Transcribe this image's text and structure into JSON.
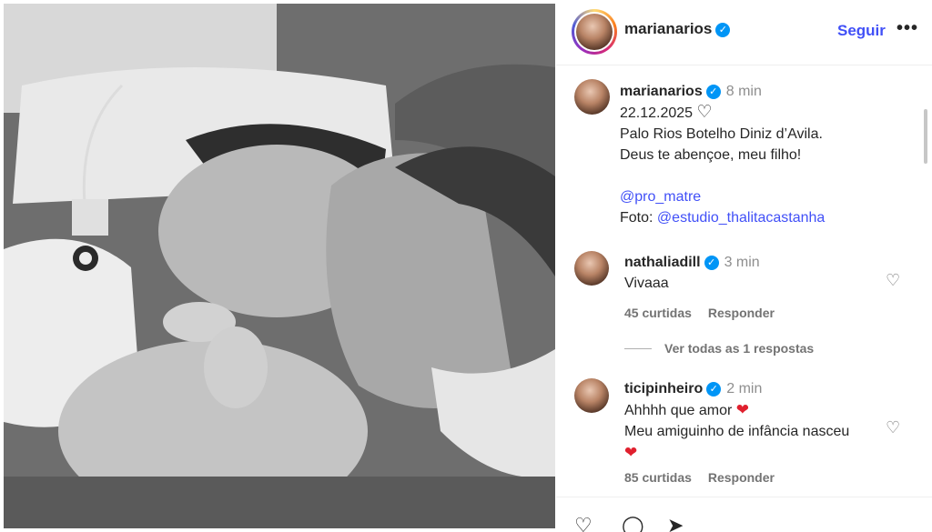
{
  "header": {
    "username": "marianarios",
    "follow_label": "Seguir",
    "more_label": "•••"
  },
  "caption": {
    "username": "marianarios",
    "time": "8 min",
    "lines": [
      "22.12.2025",
      "Palo Rios Botelho Diniz d’Avila.",
      "Deus te abençoe, meu filho!",
      "@pro_matre",
      "Foto:",
      "@estudio_thalitacastanha"
    ]
  },
  "comments": [
    {
      "username": "nathaliadill",
      "time": "3 min",
      "text": "Vivaaa",
      "likes": "45 curtidas",
      "reply_label": "Responder"
    },
    {
      "username": "ticipinheiro",
      "time": "2 min",
      "text_line1": "Ahhhh que amor",
      "text_line2": "Meu amiguinho de infância nasceu",
      "likes": "85 curtidas",
      "reply_label": "Responder"
    }
  ],
  "view_replies": "Ver todas as 1 respostas",
  "icons": {
    "verified": "✓",
    "heart_outline": "♡",
    "heart_red": "❤"
  },
  "colors": {
    "link": "#4150f7",
    "verified": "#0095f6",
    "heart": "#e0202e"
  }
}
